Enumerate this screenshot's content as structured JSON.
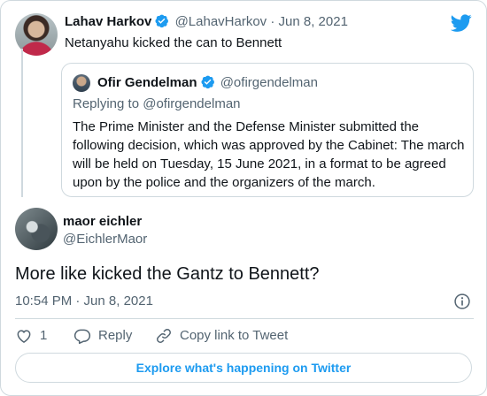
{
  "parent_tweet": {
    "author_name": "Lahav Harkov",
    "author_handle": "@LahavHarkov",
    "separator": "·",
    "date": "Jun 8, 2021",
    "text": "Netanyahu kicked the can to Bennett"
  },
  "quoted_tweet": {
    "author_name": "Ofir Gendelman",
    "author_handle": "@ofirgendelman",
    "replying_to": "Replying to @ofirgendelman",
    "text": "The Prime Minister and the Defense Minister submitted the following decision, which was approved by the Cabinet: The march will be held on Tuesday, 15 June 2021, in a format to be agreed upon by the police and the organizers of the march."
  },
  "main_tweet": {
    "author_name": "maor eichler",
    "author_handle": "@EichlerMaor",
    "text": "More like kicked the Gantz to Bennett?",
    "timestamp": "10:54 PM · Jun 8, 2021"
  },
  "actions": {
    "like_count": "1",
    "reply_label": "Reply",
    "copy_link_label": "Copy link to Tweet"
  },
  "explore_label": "Explore what's happening on Twitter",
  "icons": {
    "brand": "twitter-bird-icon",
    "verified": "verified-badge-icon",
    "info": "info-icon",
    "like": "heart-icon",
    "reply": "reply-bubble-icon",
    "copy": "link-icon"
  },
  "colors": {
    "brand_blue": "#1d9bf0",
    "text_primary": "#0f1419",
    "text_secondary": "#536471",
    "border": "#cfd9de"
  }
}
